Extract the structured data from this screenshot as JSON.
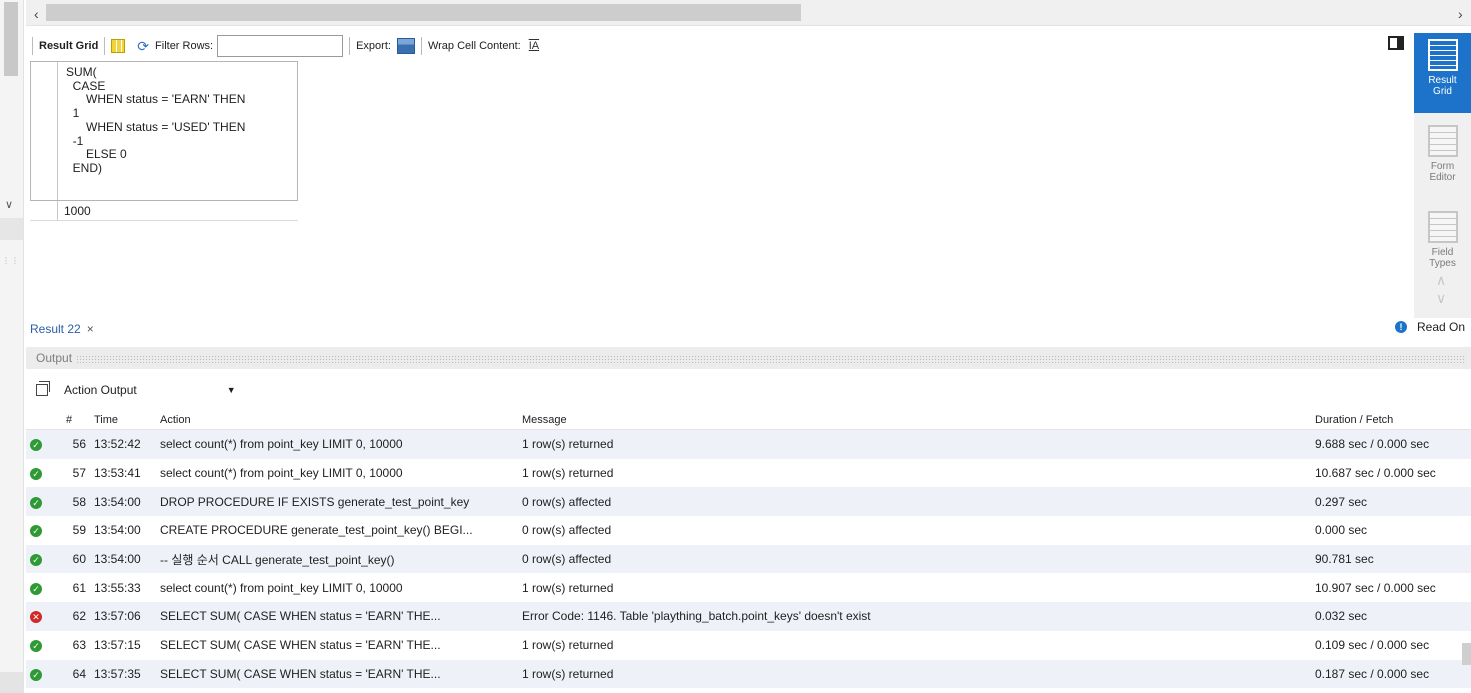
{
  "toolbar": {
    "result_grid": "Result Grid",
    "filter_rows": "Filter Rows:",
    "filter_value": "",
    "export": "Export:",
    "wrap_cell": "Wrap Cell Content:"
  },
  "grid": {
    "column_header": "SUM(\n  CASE\n      WHEN status = 'EARN' THEN\n  1\n      WHEN status = 'USED' THEN\n  -1\n      ELSE 0\n  END)",
    "rows": [
      "1000"
    ]
  },
  "sidebar": {
    "result_grid": "Result\nGrid",
    "form_editor": "Form\nEditor",
    "field_types": "Field\nTypes"
  },
  "result_tab": {
    "label": "Result 22",
    "close": "×"
  },
  "read_only": "Read On",
  "output": {
    "title": "Output",
    "selector": "Action Output",
    "columns": {
      "num": "#",
      "time": "Time",
      "action": "Action",
      "message": "Message",
      "duration": "Duration / Fetch"
    },
    "rows": [
      {
        "status": "ok",
        "num": "56",
        "time": "13:52:42",
        "action": "select count(*) from point_key LIMIT 0, 10000",
        "message": "1 row(s) returned",
        "duration": "9.688 sec / 0.000 sec"
      },
      {
        "status": "ok",
        "num": "57",
        "time": "13:53:41",
        "action": "select count(*) from point_key LIMIT 0, 10000",
        "message": "1 row(s) returned",
        "duration": "10.687 sec / 0.000 sec"
      },
      {
        "status": "ok",
        "num": "58",
        "time": "13:54:00",
        "action": "DROP PROCEDURE IF EXISTS generate_test_point_key",
        "message": "0 row(s) affected",
        "duration": "0.297 sec"
      },
      {
        "status": "ok",
        "num": "59",
        "time": "13:54:00",
        "action": "CREATE PROCEDURE generate_test_point_key() BEGI...",
        "message": "0 row(s) affected",
        "duration": "0.000 sec"
      },
      {
        "status": "ok",
        "num": "60",
        "time": "13:54:00",
        "action": "-- 실행 순서 CALL generate_test_point_key()",
        "message": "0 row(s) affected",
        "duration": "90.781 sec"
      },
      {
        "status": "ok",
        "num": "61",
        "time": "13:55:33",
        "action": "select count(*) from point_key LIMIT 0, 10000",
        "message": "1 row(s) returned",
        "duration": "10.907 sec / 0.000 sec"
      },
      {
        "status": "err",
        "num": "62",
        "time": "13:57:06",
        "action": "SELECT SUM(   CASE       WHEN status = 'EARN' THE...",
        "message": "Error Code: 1146. Table 'plaything_batch.point_keys' doesn't exist",
        "duration": "0.032 sec"
      },
      {
        "status": "ok",
        "num": "63",
        "time": "13:57:15",
        "action": "SELECT SUM(   CASE       WHEN status = 'EARN' THE...",
        "message": "1 row(s) returned",
        "duration": "0.109 sec / 0.000 sec"
      },
      {
        "status": "ok",
        "num": "64",
        "time": "13:57:35",
        "action": "SELECT SUM(   CASE       WHEN status = 'EARN' THE...",
        "message": "1 row(s) returned",
        "duration": "0.187 sec / 0.000 sec"
      }
    ]
  },
  "icons": {
    "ok": "check-circle-icon",
    "err": "error-circle-icon"
  },
  "colors": {
    "accent": "#1d73c9",
    "ok": "#2e9a35",
    "error": "#d22828"
  }
}
